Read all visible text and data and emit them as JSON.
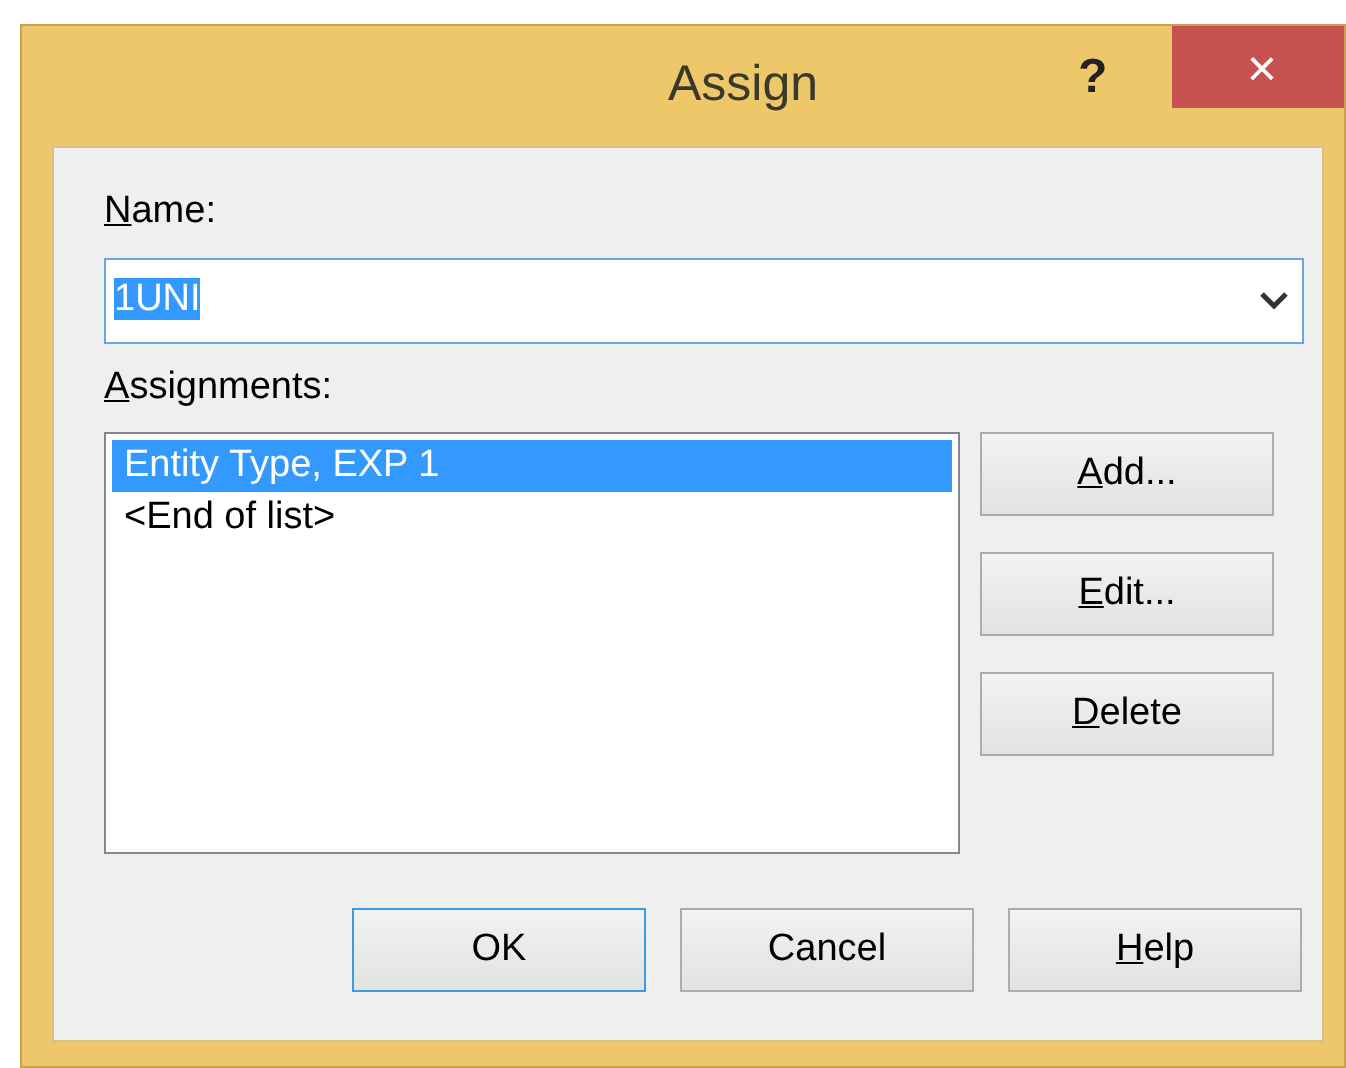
{
  "window": {
    "title": "Assign",
    "help_button": "?",
    "close_button": "×"
  },
  "name_field": {
    "label": "Name:",
    "mnemonic_underlined": true,
    "value": "1UNI",
    "text_selected": true
  },
  "assignments": {
    "label": "Assignments:",
    "mnemonic_underlined": true,
    "items": [
      {
        "text": "Entity Type, EXP 1",
        "selected": true
      },
      {
        "text": "<End of list>",
        "selected": false
      }
    ]
  },
  "side_buttons": [
    {
      "label": "Add...",
      "mnemonic_underlined": true
    },
    {
      "label": "Edit...",
      "mnemonic_underlined": true
    },
    {
      "label": "Delete",
      "mnemonic_underlined": true
    }
  ],
  "bottom_buttons": [
    {
      "label": "OK",
      "mnemonic_underlined": false,
      "default": true
    },
    {
      "label": "Cancel",
      "mnemonic_underlined": false,
      "default": false
    },
    {
      "label": "Help",
      "mnemonic_underlined": true,
      "default": false
    }
  ]
}
